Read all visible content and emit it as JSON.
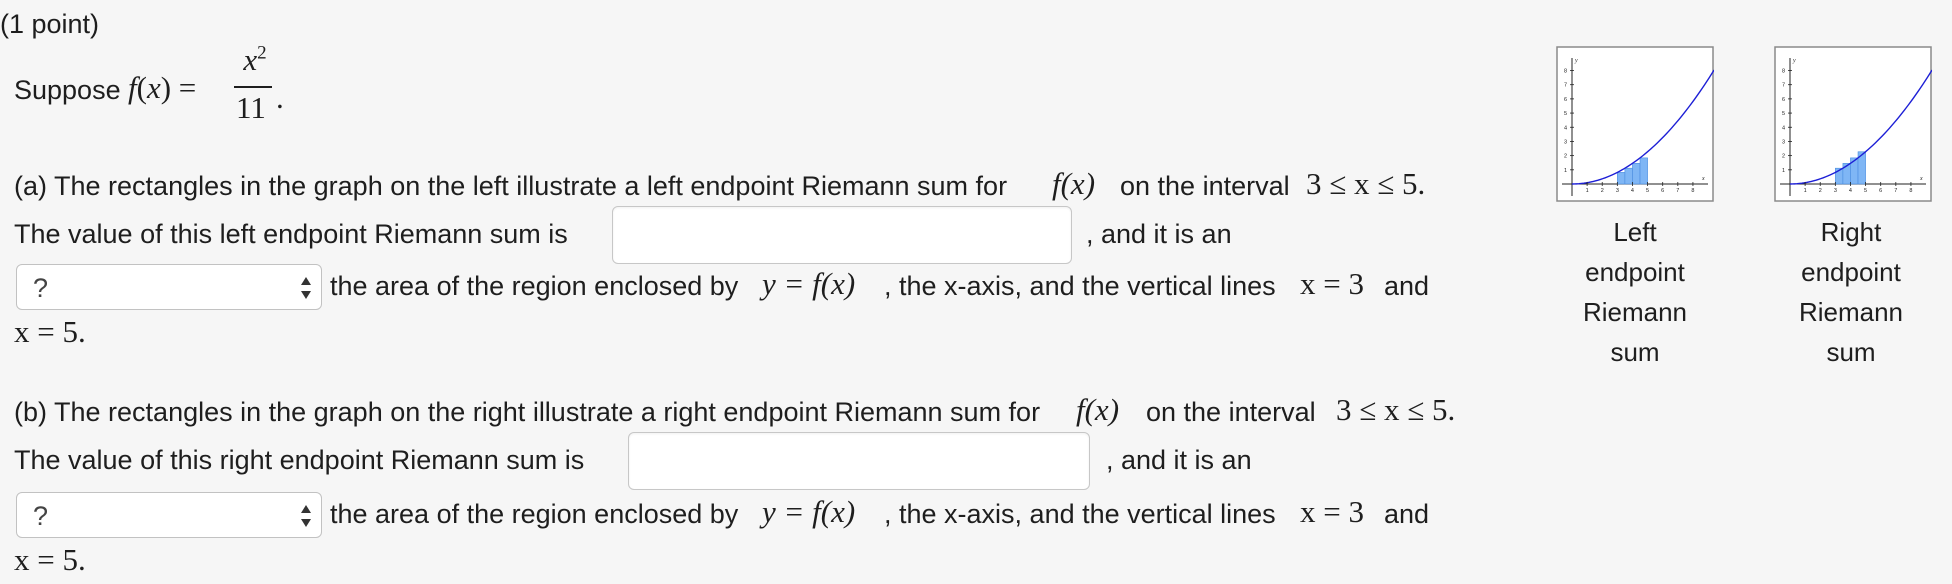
{
  "header": {
    "points": "(1 point)"
  },
  "intro": {
    "suppose": "Suppose",
    "f": "f",
    "x": "x",
    "num_base": "x",
    "num_exp": "2",
    "den": "11"
  },
  "part_a": {
    "line1_text": "(a) The rectangles in the graph on the left illustrate a left endpoint Riemann sum for",
    "line1_tail": "on the interval",
    "interval": "3 ≤ x ≤ 5.",
    "line2_text": "The value of this left endpoint Riemann sum is",
    "line2_tail": ", and it is an",
    "answer_value": "",
    "select_value": "?",
    "line3_text": "the area of the region enclosed by",
    "line3_mid": ", the x-axis, and the vertical lines",
    "line3_end": "and",
    "line4": "x = 5."
  },
  "part_b": {
    "line1_text": "(b) The rectangles in the graph on the right illustrate a right endpoint Riemann sum for",
    "line1_tail": "on the interval",
    "interval": "3 ≤ x ≤ 5.",
    "line2_text": "The value of this right endpoint Riemann sum is",
    "line2_tail": ", and it is an",
    "answer_value": "",
    "select_value": "?",
    "line3_text": "the area of the region enclosed by",
    "line3_mid": ", the x-axis, and the vertical lines",
    "line3_end": "and",
    "line4": "x = 5."
  },
  "math": {
    "fx": "f(x)",
    "y_eq_fx": "y = f(x)",
    "x_eq_3": "x = 3"
  },
  "graphs": {
    "left": {
      "caption": [
        "Left",
        "endpoint",
        "Riemann",
        "sum"
      ],
      "x_axis_label": "x",
      "y_axis_label": "y",
      "x_ticks": [
        "1",
        "2",
        "3",
        "4",
        "5",
        "6",
        "7",
        "8"
      ],
      "y_ticks": [
        "1",
        "2",
        "3",
        "4",
        "5",
        "6",
        "7",
        "8"
      ],
      "rect_heights": [
        0.818,
        1.114,
        1.455,
        1.841
      ]
    },
    "right": {
      "caption": [
        "Right",
        "endpoint",
        "Riemann",
        "sum"
      ],
      "x_axis_label": "x",
      "y_axis_label": "y",
      "x_ticks": [
        "1",
        "2",
        "3",
        "4",
        "5",
        "6",
        "7",
        "8"
      ],
      "y_ticks": [
        "1",
        "2",
        "3",
        "4",
        "5",
        "6",
        "7",
        "8"
      ],
      "rect_heights": [
        1.114,
        1.455,
        1.841,
        2.273
      ]
    },
    "curve_color": "#1d1fd6",
    "rect_fill": "#7fb6f5",
    "rect_stroke": "#4a8de0"
  }
}
